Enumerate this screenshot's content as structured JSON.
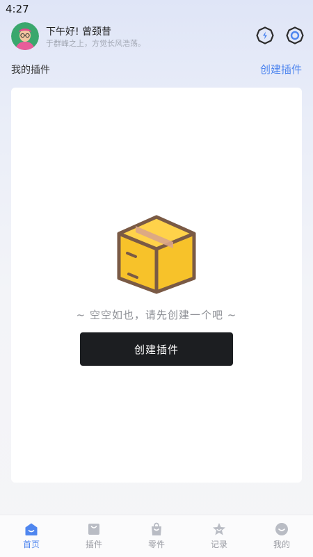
{
  "status_bar": {
    "time": "4:27"
  },
  "header": {
    "greeting": "下午好! 曾颈昔",
    "subtitle": "于群峰之上，方觉长风浩荡。",
    "icons": [
      "flash-icon",
      "settings-icon"
    ]
  },
  "section": {
    "title": "我的插件",
    "action": "创建插件"
  },
  "empty_state": {
    "illustration": "package-box-icon",
    "message": "~ 空空如也，请先创建一个吧 ~",
    "button_label": "创建插件"
  },
  "tabbar": {
    "items": [
      {
        "label": "首页",
        "icon": "home-icon",
        "active": true
      },
      {
        "label": "插件",
        "icon": "plugin-bag-icon",
        "active": false
      },
      {
        "label": "零件",
        "icon": "parts-bag-icon",
        "active": false
      },
      {
        "label": "记录",
        "icon": "star-record-icon",
        "active": false
      },
      {
        "label": "我的",
        "icon": "profile-smile-icon",
        "active": false
      }
    ]
  },
  "colors": {
    "accent": "#4f86ef",
    "button_bg": "#1c1e21",
    "box_yellow": "#f7c22a",
    "box_outline": "#7a5a45",
    "tab_inactive": "#b9bcc4"
  }
}
